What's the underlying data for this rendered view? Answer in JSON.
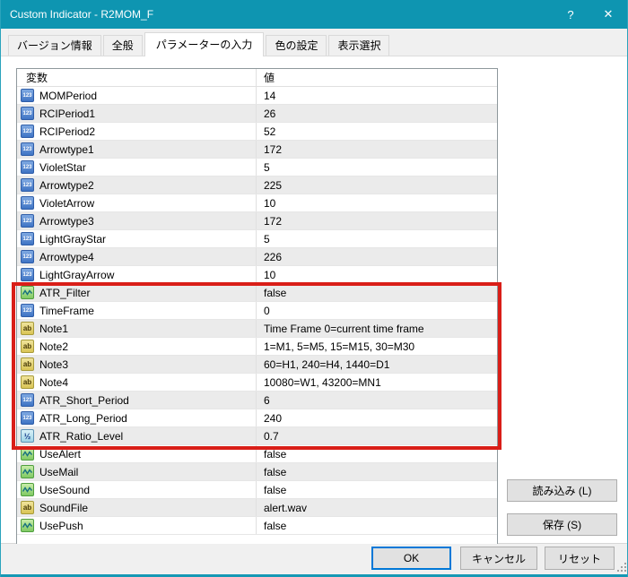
{
  "window": {
    "title": "Custom Indicator - R2MOM_F",
    "help_label": "?",
    "close_label": "✕"
  },
  "colors": {
    "titlebar_teal": "#0e95b1",
    "bottom_border_teal": "#1598b4",
    "highlight_red": "#d91e18",
    "ok_focus_blue": "#0078d7",
    "row_alt_gray": "#ebebeb"
  },
  "tabs": [
    {
      "label": "バージョン情報",
      "active": false
    },
    {
      "label": "全般",
      "active": false
    },
    {
      "label": "パラメーターの入力",
      "active": true
    },
    {
      "label": "色の設定",
      "active": false
    },
    {
      "label": "表示選択",
      "active": false
    }
  ],
  "table": {
    "headers": [
      "変数",
      "値"
    ],
    "icon_glyphs": {
      "int": "123",
      "str": "ab",
      "dbl": "½",
      "bool": "zigzag-wave"
    },
    "rows": [
      {
        "name": "MOMPeriod",
        "value": "14",
        "type": "int"
      },
      {
        "name": "RCIPeriod1",
        "value": "26",
        "type": "int"
      },
      {
        "name": "RCIPeriod2",
        "value": "52",
        "type": "int"
      },
      {
        "name": "Arrowtype1",
        "value": "172",
        "type": "int"
      },
      {
        "name": "VioletStar",
        "value": "5",
        "type": "int"
      },
      {
        "name": "Arrowtype2",
        "value": "225",
        "type": "int"
      },
      {
        "name": "VioletArrow",
        "value": "10",
        "type": "int"
      },
      {
        "name": "Arrowtype3",
        "value": "172",
        "type": "int"
      },
      {
        "name": "LightGrayStar",
        "value": "5",
        "type": "int"
      },
      {
        "name": "Arrowtype4",
        "value": "226",
        "type": "int"
      },
      {
        "name": "LightGrayArrow",
        "value": "10",
        "type": "int"
      },
      {
        "name": "ATR_Filter",
        "value": "false",
        "type": "bool"
      },
      {
        "name": "TimeFrame",
        "value": "0",
        "type": "int"
      },
      {
        "name": "Note1",
        "value": "Time Frame 0=current time frame",
        "type": "str"
      },
      {
        "name": "Note2",
        "value": "1=M1, 5=M5, 15=M15, 30=M30",
        "type": "str"
      },
      {
        "name": "Note3",
        "value": "60=H1, 240=H4, 1440=D1",
        "type": "str"
      },
      {
        "name": "Note4",
        "value": "10080=W1, 43200=MN1",
        "type": "str"
      },
      {
        "name": "ATR_Short_Period",
        "value": "6",
        "type": "int"
      },
      {
        "name": "ATR_Long_Period",
        "value": "240",
        "type": "int"
      },
      {
        "name": "ATR_Ratio_Level",
        "value": "0.7",
        "type": "dbl"
      },
      {
        "name": "UseAlert",
        "value": "false",
        "type": "bool"
      },
      {
        "name": "UseMail",
        "value": "false",
        "type": "bool"
      },
      {
        "name": "UseSound",
        "value": "false",
        "type": "bool"
      },
      {
        "name": "SoundFile",
        "value": "alert.wav",
        "type": "str"
      },
      {
        "name": "UsePush",
        "value": "false",
        "type": "bool"
      }
    ],
    "highlighted_rows": [
      "ATR_Filter",
      "TimeFrame",
      "Note1",
      "Note2",
      "Note3",
      "Note4",
      "ATR_Short_Period",
      "ATR_Long_Period",
      "ATR_Ratio_Level"
    ]
  },
  "side_buttons": {
    "load": "読み込み (L)",
    "save": "保存 (S)"
  },
  "footer_buttons": {
    "ok": "OK",
    "cancel": "キャンセル",
    "reset": "リセット"
  }
}
